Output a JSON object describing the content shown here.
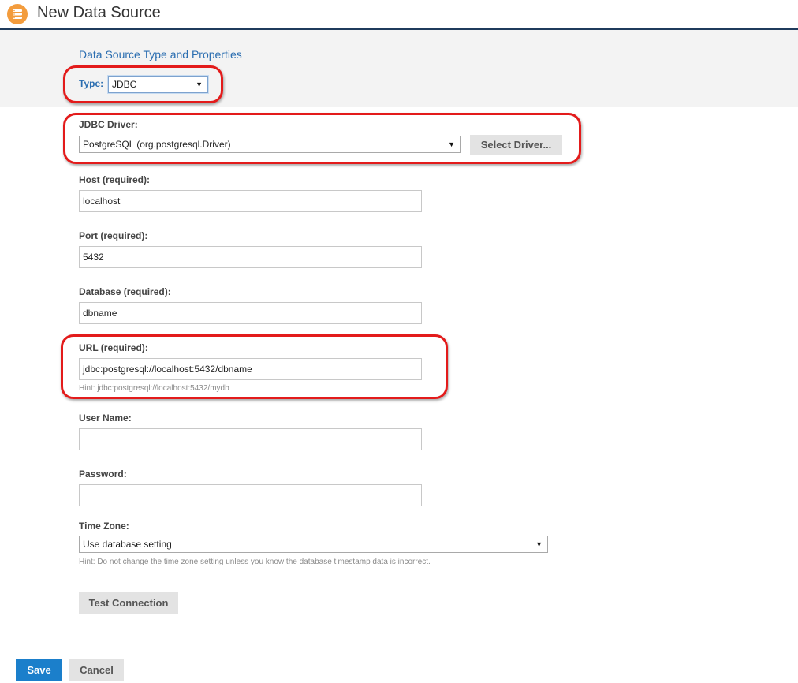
{
  "header": {
    "title": "New Data Source",
    "icon": "database-icon",
    "accent": "#f39c3d"
  },
  "section": {
    "title": "Data Source Type and Properties"
  },
  "type": {
    "label": "Type:",
    "value": "JDBC"
  },
  "driver": {
    "label": "JDBC Driver:",
    "value": "PostgreSQL (org.postgresql.Driver)",
    "button": "Select Driver..."
  },
  "host": {
    "label": "Host (required):",
    "value": "localhost"
  },
  "port": {
    "label": "Port (required):",
    "value": "5432"
  },
  "database": {
    "label": "Database (required):",
    "value": "dbname"
  },
  "url": {
    "label": "URL (required):",
    "value": "jdbc:postgresql://localhost:5432/dbname",
    "hint": "Hint: jdbc:postgresql://localhost:5432/mydb"
  },
  "username": {
    "label": "User Name:",
    "value": ""
  },
  "password": {
    "label": "Password:",
    "value": ""
  },
  "timezone": {
    "label": "Time Zone:",
    "value": "Use database setting",
    "hint": "Hint: Do not change the time zone setting unless you know the database timestamp data is incorrect."
  },
  "actions": {
    "test": "Test Connection",
    "save": "Save",
    "cancel": "Cancel"
  },
  "colors": {
    "primary": "#1b7fcb",
    "callout": "#e31b1b",
    "link": "#2a6db0"
  }
}
